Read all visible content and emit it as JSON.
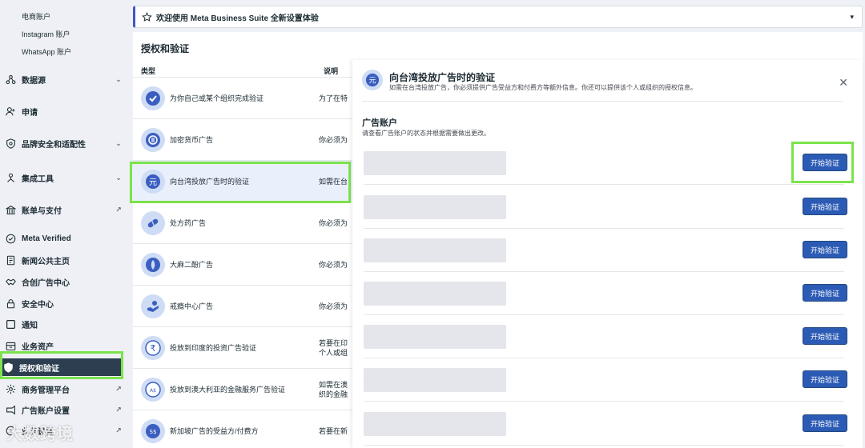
{
  "sidebar": {
    "sub_items": [
      "电商账户",
      "Instagram 账户",
      "WhatsApp 账户"
    ],
    "items": [
      {
        "label": "数据源",
        "icon": "data-sources-icon",
        "trail": "chevron-down-icon"
      },
      {
        "label": "申请",
        "icon": "person-add-icon",
        "trail": ""
      },
      {
        "label": "品牌安全和适配性",
        "icon": "shield-icon",
        "trail": "chevron-down-icon"
      },
      {
        "label": "集成工具",
        "icon": "integration-icon",
        "trail": "chevron-down-icon"
      },
      {
        "label": "账单与支付",
        "icon": "bank-icon",
        "trail": "external-link-icon"
      },
      {
        "label": "Meta Verified",
        "icon": "verified-icon",
        "trail": ""
      },
      {
        "label": "新闻公共主页",
        "icon": "news-icon",
        "trail": ""
      },
      {
        "label": "合创广告中心",
        "icon": "handshake-icon",
        "trail": ""
      },
      {
        "label": "安全中心",
        "icon": "lock-icon",
        "trail": ""
      },
      {
        "label": "通知",
        "icon": "notification-icon",
        "trail": ""
      },
      {
        "label": "业务资产",
        "icon": "briefcase-icon",
        "trail": ""
      },
      {
        "label": "授权和验证",
        "icon": "shield-check-icon",
        "trail": "",
        "active": true
      },
      {
        "label": "商务管理平台",
        "icon": "gear-icon",
        "trail": "external-link-icon"
      },
      {
        "label": "广告账户设置",
        "icon": "ad-settings-icon",
        "trail": "external-link-icon"
      },
      {
        "label": "业务设置",
        "icon": "business-settings-icon",
        "trail": "external-link-icon"
      }
    ],
    "watermark": "大数跨境"
  },
  "banner": {
    "text": "欢迎使用 Meta Business Suite 全新设置体验"
  },
  "main": {
    "title": "授权和验证",
    "col_type": "类型",
    "col_desc": "说明",
    "rows": [
      {
        "name": "为你自己或某个组织完成验证",
        "desc": "为了在特",
        "icon": "check-icon"
      },
      {
        "name": "加密货币广告",
        "desc": "你必须为",
        "icon": "crypto-icon"
      },
      {
        "name": "向台湾投放广告时的验证",
        "desc": "如需在台",
        "icon": "yuan-icon"
      },
      {
        "name": "处方药广告",
        "desc": "你必须为",
        "icon": "pill-icon"
      },
      {
        "name": "大麻二酚广告",
        "desc": "你必须为",
        "icon": "leaf-icon"
      },
      {
        "name": "戒瘾中心广告",
        "desc": "你必须为",
        "icon": "care-icon"
      },
      {
        "name": "投放到印度的投资广告验证",
        "desc": "若要在印\n个人或组",
        "icon": "rupee-icon"
      },
      {
        "name": "投放到澳大利亚的金融服务广告验证",
        "desc": "如需在澳\n织的金融",
        "icon": "aud-icon"
      },
      {
        "name": "新加坡广告的受益方/付费方",
        "desc": "若要在新",
        "icon": "sgd-icon"
      }
    ]
  },
  "detail": {
    "title": "向台湾投放广告时的验证",
    "subtitle": "如需在台湾投放广告，你必须提供广告受益方和付费方等额外信息。你还可以提供该个人或组织的授权信息。",
    "section_title": "广告账户",
    "section_sub": "请查看广告账户的状态并根据需要做出更改。",
    "button_label": "开始验证",
    "account_count": 7
  },
  "colors": {
    "accent": "#2b5bb5",
    "highlight": "#7ce34b",
    "active_nav": "#2c3e50"
  }
}
